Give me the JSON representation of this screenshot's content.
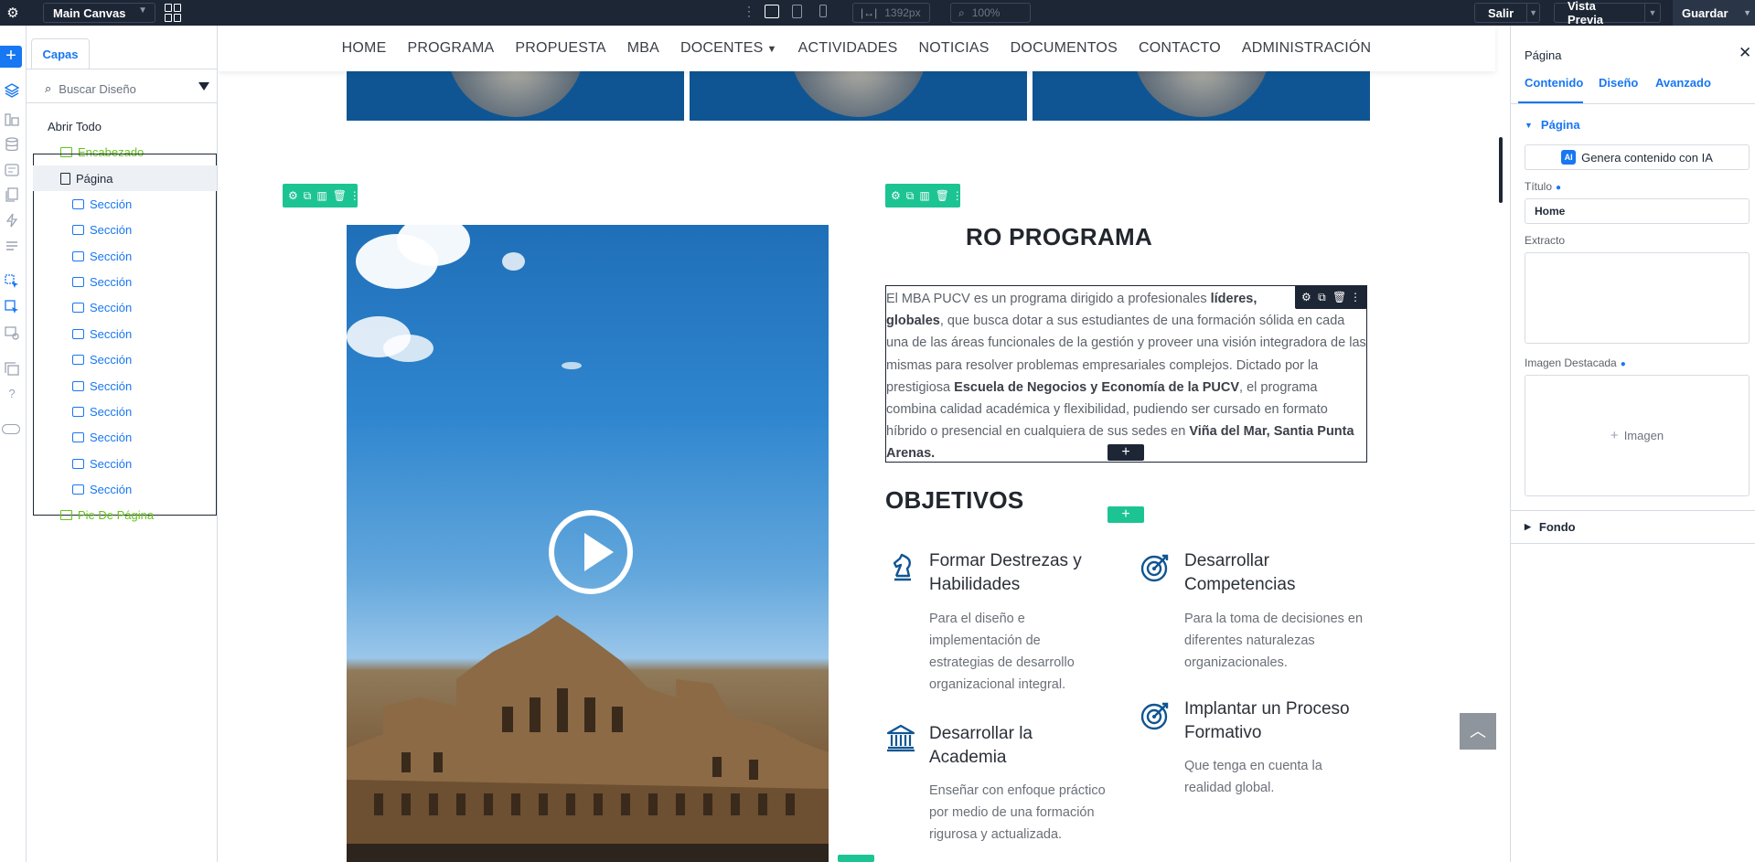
{
  "topbar": {
    "canvas_select": "Main Canvas",
    "width_readout": "1392px",
    "zoom_readout": "100%",
    "exit_label": "Salir",
    "preview_label": "Vista Previa",
    "save_label": "Guardar"
  },
  "layers": {
    "tab_label": "Capas",
    "search_placeholder": "Buscar Diseño",
    "open_all": "Abrir Todo",
    "header_item": "Encabezado",
    "page_item": "Página",
    "sections": [
      "Sección",
      "Sección",
      "Sección",
      "Sección",
      "Sección",
      "Sección",
      "Sección",
      "Sección",
      "Sección",
      "Sección",
      "Sección",
      "Sección"
    ],
    "footer_item": "Pie De Página"
  },
  "site": {
    "nav": [
      "HOME",
      "PROGRAMA",
      "PROPUESTA",
      "MBA",
      "DOCENTES",
      "ACTIVIDADES",
      "NOTICIAS",
      "DOCUMENTOS",
      "CONTACTO",
      "ADMINISTRACIÓN"
    ],
    "program_title": "RO PROGRAMA",
    "intro_parts": [
      "El MBA PUCV es un programa dirigido a profesionales ",
      "líderes,",
      " ",
      "globales",
      ", que busca dotar a sus estudiantes de una formación sólida en cada una de las áreas funcionales de la gestión y proveer una visión integradora de las mismas para resolver problemas empresariales complejos. Dictado por la prestigiosa ",
      "Escuela de Negocios y Economía de la PUCV",
      ", el programa combina calidad académica y flexibilidad, pudiendo ser cursado en formato híbrido o presencial en cualquiera de sus sedes en ",
      "Viña del Mar, Santia",
      "Punta Arenas."
    ],
    "objectives_title": "OBJETIVOS",
    "objectives": [
      {
        "title": "Formar Destrezas y Habilidades",
        "desc": "Para el diseño e implementación de estrategias de desarrollo organizacional integral.",
        "icon": "chess-knight-icon"
      },
      {
        "title": "Desarrollar Competencias",
        "desc": "Para la toma de decisiones en diferentes naturalezas organizacionales.",
        "icon": "target-icon"
      },
      {
        "title": "Desarrollar la Academia",
        "desc": "Enseñar con enfoque práctico por medio de una formación rigurosa y actualizada.",
        "icon": "institution-icon"
      },
      {
        "title": "Implantar un Proceso Formativo",
        "desc": "Que tenga en cuenta la realidad global.",
        "icon": "target-icon"
      }
    ]
  },
  "panel": {
    "title": "Página",
    "tabs": [
      "Contenido",
      "Diseño",
      "Avanzado"
    ],
    "section_page": "Página",
    "ai_button": "Genera contenido con IA",
    "ai_badge": "AI",
    "title_label": "Título",
    "title_value": "Home",
    "excerpt_label": "Extracto",
    "featured_label": "Imagen Destacada",
    "image_button": "Imagen",
    "section_background": "Fondo"
  },
  "colors": {
    "topbar": "#1d2635",
    "accent": "#1877f2",
    "green": "#1dc493",
    "brand_blue": "#0f5593"
  }
}
